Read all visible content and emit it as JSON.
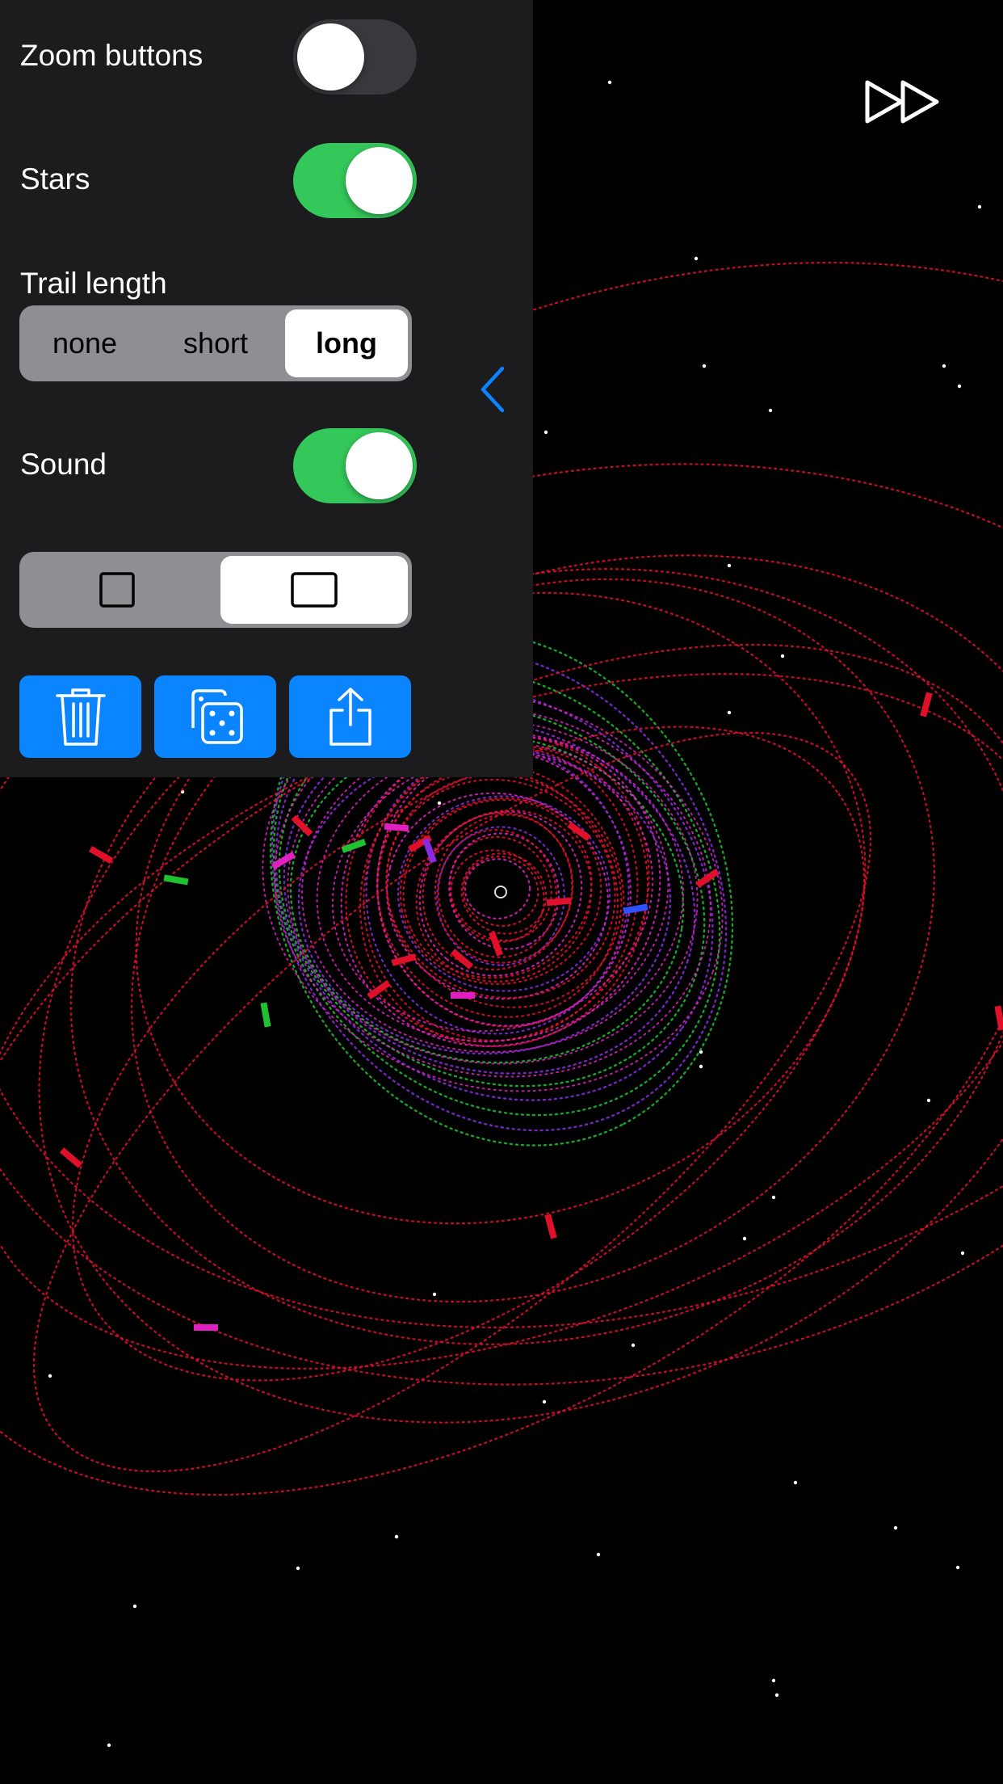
{
  "settings": {
    "zoom_buttons": {
      "label": "Zoom buttons",
      "on": false
    },
    "stars": {
      "label": "Stars",
      "on": true
    },
    "trail_length": {
      "label": "Trail length",
      "options": [
        "none",
        "short",
        "long"
      ],
      "selected": "long"
    },
    "sound": {
      "label": "Sound",
      "on": true
    },
    "aspect": {
      "options": [
        "square-icon",
        "wide-rectangle-icon"
      ],
      "selected": "wide-rectangle-icon"
    },
    "actions": [
      "trash-icon",
      "dice-icon",
      "share-icon"
    ]
  },
  "controls": {
    "collapse_icon": "chevron-left-icon",
    "speed_icon": "fast-forward-icon"
  },
  "colors": {
    "panel_bg": "#1c1c1e",
    "switch_on": "#34c759",
    "switch_off": "#39393d",
    "accent_blue": "#0a84ff",
    "segment_bg": "#8e8e93",
    "trail_red": "#e0102a",
    "trail_green": "#20c030",
    "trail_magenta": "#e020c0",
    "trail_purple": "#8a2be2",
    "trail_blue": "#3050ff"
  }
}
